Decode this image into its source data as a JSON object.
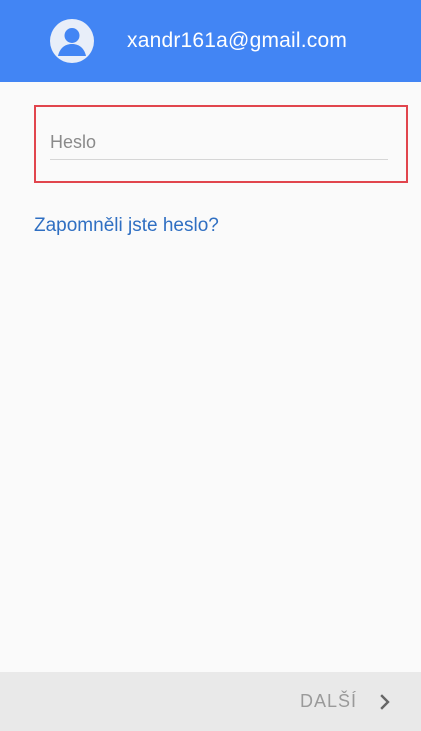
{
  "header": {
    "account_email": "xandr161a@gmail.com",
    "avatar_icon": "account-circle-icon",
    "background_color": "#4285f4"
  },
  "form": {
    "password": {
      "placeholder": "Heslo",
      "value": "",
      "highlight_color": "#e1454d"
    },
    "forgot_password_label": "Zapomněli jste heslo?"
  },
  "footer": {
    "next_label": "DALŠÍ",
    "next_icon": "chevron-right-icon"
  }
}
